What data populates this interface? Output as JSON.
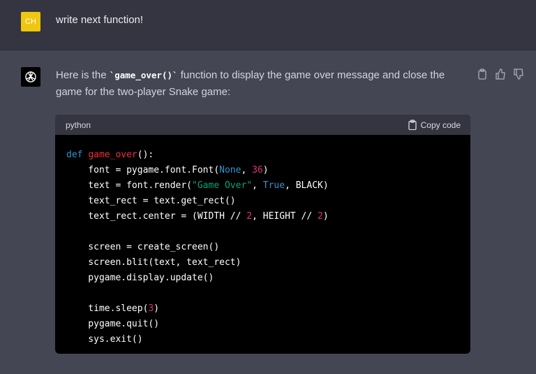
{
  "user": {
    "initials": "CH",
    "message": "write next function!"
  },
  "assistant": {
    "intro_before": "Here is the ",
    "intro_code": "`game_over()`",
    "intro_after": " function to display the game over message and close the game for the two-player Snake game:"
  },
  "code_block": {
    "language": "python",
    "copy_label": "Copy code",
    "lines": [
      [
        [
          "def ",
          "kw"
        ],
        [
          "game_over",
          "fn"
        ],
        [
          "():",
          ""
        ]
      ],
      [
        [
          "    font = pygame.font.Font(",
          ""
        ],
        [
          "None",
          "kw"
        ],
        [
          ", ",
          ""
        ],
        [
          "36",
          "num"
        ],
        [
          ")",
          ""
        ]
      ],
      [
        [
          "    text = font.render(",
          ""
        ],
        [
          "\"Game Over\"",
          "str"
        ],
        [
          ", ",
          ""
        ],
        [
          "True",
          "kw"
        ],
        [
          ", BLACK)",
          ""
        ]
      ],
      [
        [
          "    text_rect = text.get_rect()",
          ""
        ]
      ],
      [
        [
          "    text_rect.center = (WIDTH // ",
          ""
        ],
        [
          "2",
          "num"
        ],
        [
          ", HEIGHT // ",
          ""
        ],
        [
          "2",
          "num"
        ],
        [
          ")",
          ""
        ]
      ],
      [
        [
          "",
          ""
        ]
      ],
      [
        [
          "    screen = create_screen()",
          ""
        ]
      ],
      [
        [
          "    screen.blit(text, text_rect)",
          ""
        ]
      ],
      [
        [
          "    pygame.display.update()",
          ""
        ]
      ],
      [
        [
          "",
          ""
        ]
      ],
      [
        [
          "    time.sleep(",
          ""
        ],
        [
          "3",
          "num"
        ],
        [
          ")",
          ""
        ]
      ],
      [
        [
          "    pygame.quit()",
          ""
        ]
      ],
      [
        [
          "    sys.exit()",
          ""
        ]
      ]
    ]
  }
}
